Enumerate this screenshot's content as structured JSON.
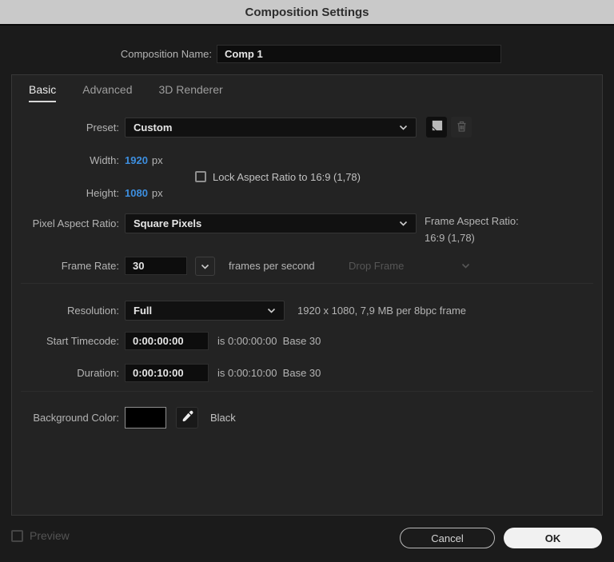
{
  "title": "Composition Settings",
  "composition_name": {
    "label": "Composition Name:",
    "value": "Comp 1"
  },
  "tabs": {
    "basic": "Basic",
    "advanced": "Advanced",
    "renderer": "3D Renderer",
    "active": "Basic"
  },
  "preset": {
    "label": "Preset:",
    "value": "Custom"
  },
  "dimensions": {
    "width_label": "Width:",
    "width_value": "1920",
    "width_unit": "px",
    "height_label": "Height:",
    "height_value": "1080",
    "height_unit": "px",
    "lock_label": "Lock Aspect Ratio to 16:9 (1,78)",
    "lock_checked": false
  },
  "pixel_aspect_ratio": {
    "label": "Pixel Aspect Ratio:",
    "value": "Square Pixels",
    "frame_aspect_label": "Frame Aspect Ratio:",
    "frame_aspect_value": "16:9 (1,78)"
  },
  "frame_rate": {
    "label": "Frame Rate:",
    "value": "30",
    "unit": "frames per second",
    "drop_frame_label": "Drop Frame",
    "drop_frame_enabled": false
  },
  "resolution": {
    "label": "Resolution:",
    "value": "Full",
    "info": "1920 x 1080, 7,9 MB per 8bpc frame"
  },
  "start_timecode": {
    "label": "Start Timecode:",
    "value": "0:00:00:00",
    "info": "is 0:00:00:00  Base 30"
  },
  "duration": {
    "label": "Duration:",
    "value": "0:00:10:00",
    "info": "is 0:00:10:00  Base 30"
  },
  "background_color": {
    "label": "Background Color:",
    "value": "Black",
    "swatch_color": "#000000"
  },
  "footer": {
    "preview_label": "Preview",
    "preview_checked": false,
    "cancel_label": "Cancel",
    "ok_label": "OK"
  },
  "icons": {
    "preset_save": "save-preset-icon",
    "preset_delete": "trash-icon",
    "dropdowns": "chevron-down-icon",
    "color_picker": "eyedropper-icon"
  },
  "colors": {
    "accent_blue": "#3d8fe0",
    "titlebar_bg": "#c9c9c9",
    "dialog_bg": "#1b1b1b",
    "panel_bg": "#232323",
    "ok_button_bg": "#f1f1f1"
  }
}
